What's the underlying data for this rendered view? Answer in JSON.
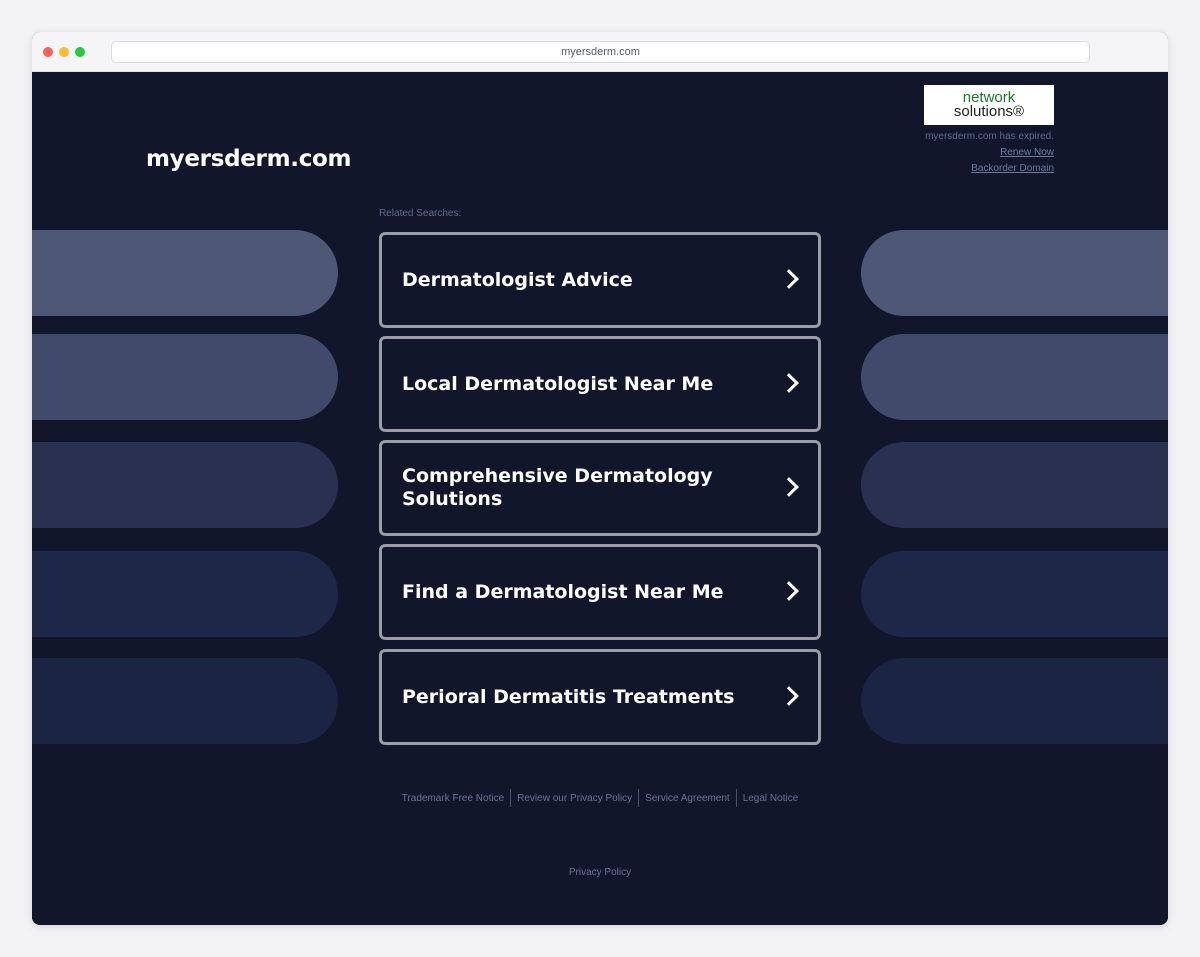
{
  "browser": {
    "url": "myersderm.com"
  },
  "header": {
    "site_title": "myersderm.com",
    "logo_line1": "network",
    "logo_line2": "solutions®",
    "expired_text": "myersderm.com has expired.",
    "renew_label": "Renew Now",
    "backorder_label": "Backorder Domain"
  },
  "related": {
    "label": "Related Searches:",
    "items": [
      {
        "label": "Dermatologist Advice"
      },
      {
        "label": "Local Dermatologist Near Me"
      },
      {
        "label": "Comprehensive Dermatology Solutions"
      },
      {
        "label": "Find a Dermatologist Near Me"
      },
      {
        "label": "Perioral Dermatitis Treatments"
      }
    ]
  },
  "decor_colors": [
    "#4e5876",
    "#414a6a",
    "#2a3150",
    "#1f2748",
    "#1c2444"
  ],
  "footer": {
    "links": [
      "Trademark Free Notice",
      "Review our Privacy Policy",
      "Service Agreement",
      "Legal Notice"
    ],
    "privacy": "Privacy Policy"
  }
}
